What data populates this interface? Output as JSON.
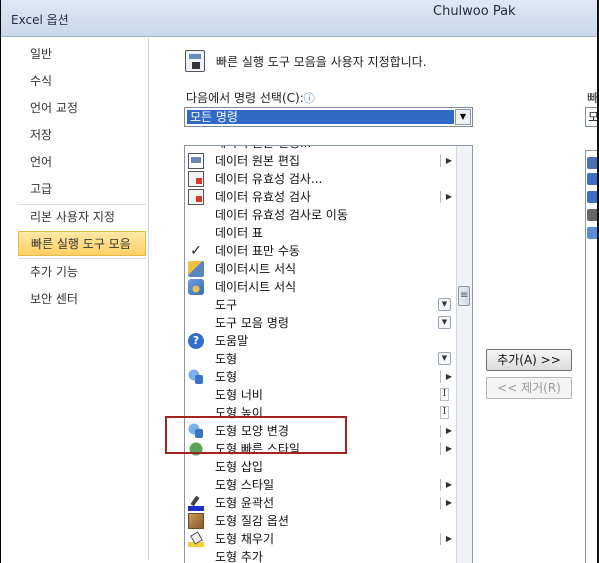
{
  "window": {
    "title": "Excel 옵션",
    "user": "Chulwoo Pak"
  },
  "sidebar": {
    "items": [
      {
        "label": "일반"
      },
      {
        "label": "수식"
      },
      {
        "label": "언어 교정"
      },
      {
        "label": "저장"
      },
      {
        "label": "언어"
      },
      {
        "label": "고급"
      },
      {
        "label": "리본 사용자 지정"
      },
      {
        "label": "빠른 실행 도구 모음",
        "selected": true
      },
      {
        "label": "추가 기능"
      },
      {
        "label": "보안 센터"
      }
    ]
  },
  "main": {
    "header": "빠른 실행 도구 모음을 사용자 지정합니다.",
    "choose_label": "다음에서 명령 선택(C):",
    "choose_value": "모든 명령",
    "right_label": "빠",
    "right_value": "모",
    "commands": [
      {
        "label": "데이터 원본 편집",
        "icon": "doc-icon",
        "indicator": "arrow"
      },
      {
        "label": "데이터 유효성 검사...",
        "icon": "data-validation-icon",
        "indicator": ""
      },
      {
        "label": "데이터 유효성 검사",
        "icon": "data-validation-icon",
        "indicator": "arrow"
      },
      {
        "label": "데이터 유효성 검사로 이동",
        "icon": "",
        "indicator": ""
      },
      {
        "label": "데이터 표",
        "icon": "",
        "indicator": ""
      },
      {
        "label": "데이터 표만 수동",
        "icon": "check-icon",
        "indicator": ""
      },
      {
        "label": "데이터시트 서식",
        "icon": "datasheet-format-icon",
        "indicator": ""
      },
      {
        "label": "데이터시트 서식",
        "icon": "datasheet-format2-icon",
        "indicator": ""
      },
      {
        "label": "도구",
        "icon": "",
        "indicator": "dropdown"
      },
      {
        "label": "도구 모음 명령",
        "icon": "",
        "indicator": "dropdown"
      },
      {
        "label": "도움말",
        "icon": "help-icon",
        "indicator": ""
      },
      {
        "label": "도형",
        "icon": "",
        "indicator": "dropdown"
      },
      {
        "label": "도형",
        "icon": "shape-icon",
        "indicator": "arrow"
      },
      {
        "label": "도형 너비",
        "icon": "",
        "indicator": "ibeam"
      },
      {
        "label": "도형 높이",
        "icon": "",
        "indicator": "ibeam"
      },
      {
        "label": "도형 모양 변경",
        "icon": "shape-icon",
        "indicator": "arrow"
      },
      {
        "label": "도형 빠른 스타일",
        "icon": "quick-style-icon",
        "indicator": "arrow"
      },
      {
        "label": "도형 삽입",
        "icon": "",
        "indicator": ""
      },
      {
        "label": "도형 스타일",
        "icon": "",
        "indicator": "arrow"
      },
      {
        "label": "도형 윤곽선",
        "icon": "pen-outline-icon",
        "indicator": "arrow"
      },
      {
        "label": "도형 질감 옵션",
        "icon": "texture-icon",
        "indicator": ""
      },
      {
        "label": "도형 채우기",
        "icon": "fill-bucket-icon",
        "indicator": "arrow"
      },
      {
        "label": "도형 추가",
        "icon": "",
        "indicator": ""
      }
    ],
    "add_button": "추가(A) >>",
    "remove_button": "<< 제거(R)"
  },
  "colors": {
    "accent": "#3169c6",
    "selected_nav": "#ffd163",
    "highlight_box": "#a32222"
  }
}
